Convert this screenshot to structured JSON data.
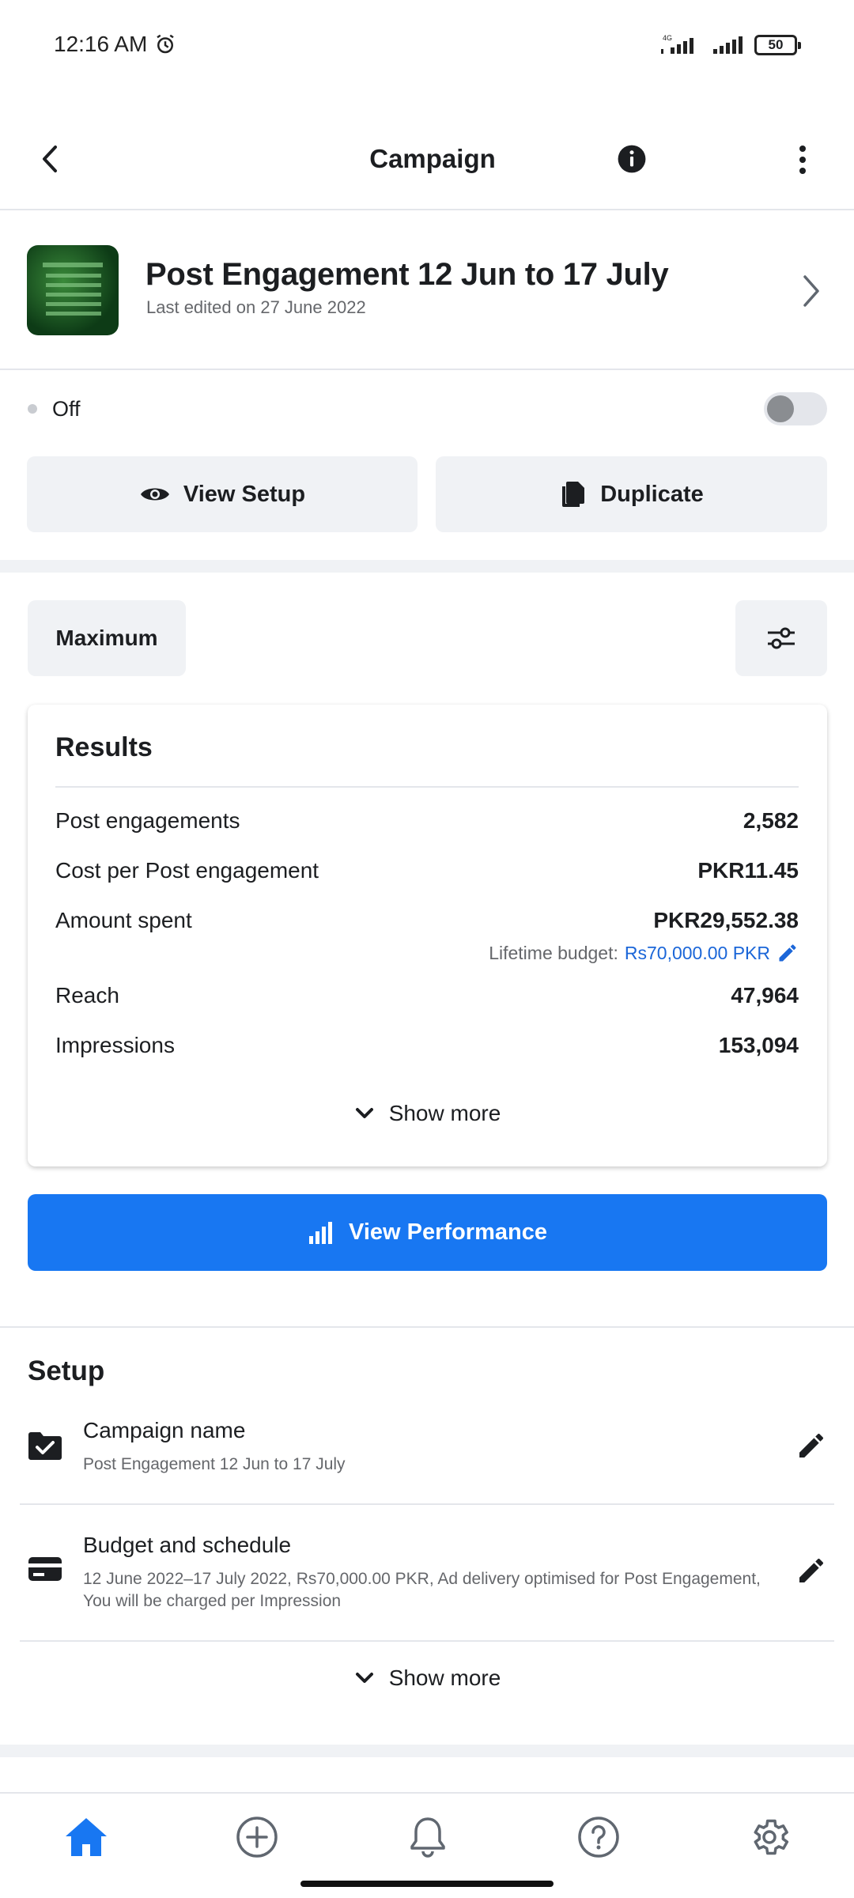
{
  "status_bar": {
    "time": "12:16 AM",
    "network": "4G",
    "battery": "50"
  },
  "app_bar": {
    "title": "Campaign"
  },
  "campaign": {
    "title": "Post Engagement 12 Jun to 17 July",
    "last_edited": "Last edited on 27 June 2022",
    "status": "Off",
    "toggle_on": false
  },
  "actions": {
    "view_setup": "View Setup",
    "duplicate": "Duplicate"
  },
  "filters": {
    "date_range": "Maximum"
  },
  "results": {
    "title": "Results",
    "rows": [
      {
        "label": "Post engagements",
        "value": "2,582"
      },
      {
        "label": "Cost per Post engagement",
        "value": "PKR11.45"
      },
      {
        "label": "Amount spent",
        "value": "PKR29,552.38"
      },
      {
        "label": "Reach",
        "value": "47,964"
      },
      {
        "label": "Impressions",
        "value": "153,094"
      }
    ],
    "lifetime_budget_label": "Lifetime budget:",
    "lifetime_budget_value": "Rs70,000.00 PKR",
    "show_more": "Show more"
  },
  "view_performance": "View Performance",
  "setup": {
    "title": "Setup",
    "items": [
      {
        "label": "Campaign name",
        "value": "Post Engagement 12 Jun to 17 July"
      },
      {
        "label": "Budget and schedule",
        "value": "12 June 2022–17 July 2022, Rs70,000.00 PKR, Ad delivery optimised for Post Engagement, You will be charged per Impression"
      }
    ],
    "show_more": "Show more"
  },
  "bottom_nav": [
    "home-icon",
    "create-icon",
    "notifications-icon",
    "help-icon",
    "settings-icon"
  ],
  "colors": {
    "accent": "#1877f2",
    "link": "#1b66d8",
    "text": "#1c1e21",
    "secondary": "#65676b",
    "grey_bg": "#f0f2f5"
  }
}
